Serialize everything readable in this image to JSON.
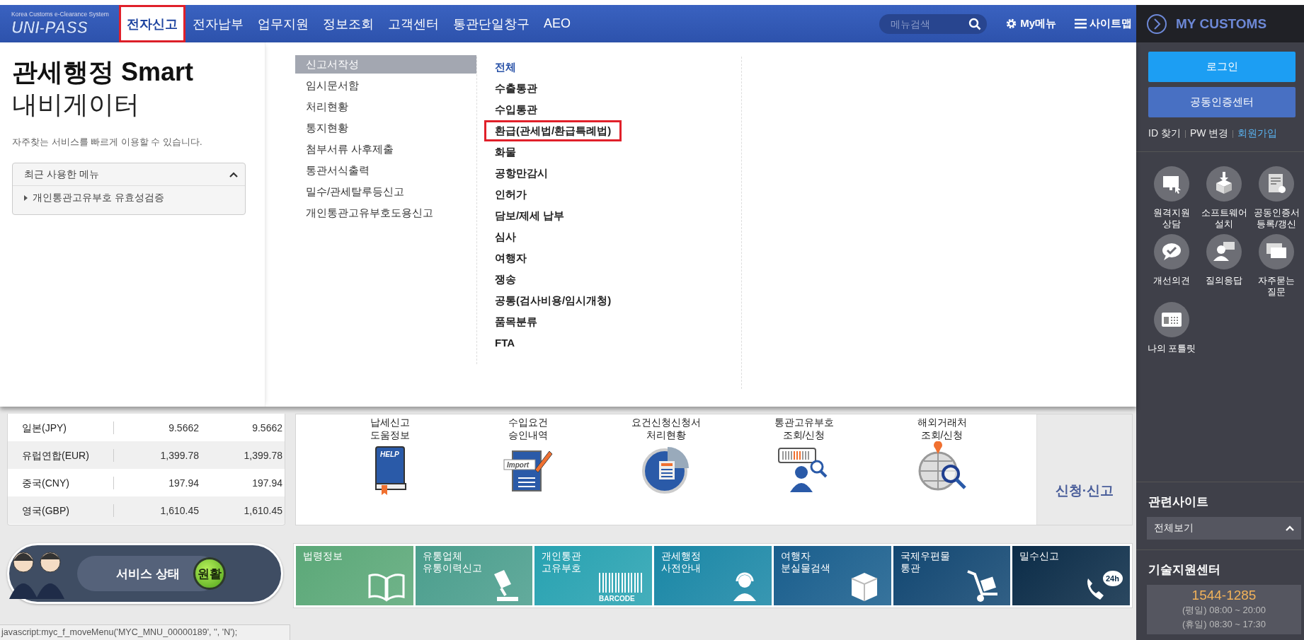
{
  "logo": {
    "subtitle": "Korea Customs e-Clearance System",
    "name": "UNI-PASS"
  },
  "nav": [
    {
      "label": "전자신고",
      "selected": true,
      "highlighted": true
    },
    {
      "label": "전자납부",
      "selected": false,
      "highlighted": false
    },
    {
      "label": "업무지원",
      "selected": false,
      "highlighted": false
    },
    {
      "label": "정보조회",
      "selected": false,
      "highlighted": false
    },
    {
      "label": "고객센터",
      "selected": false,
      "highlighted": false
    },
    {
      "label": "통관단일창구",
      "selected": false,
      "highlighted": false
    },
    {
      "label": "AEO",
      "selected": false,
      "highlighted": false
    }
  ],
  "search": {
    "placeholder": "메뉴검색"
  },
  "nav_tools": [
    {
      "label": "My메뉴",
      "kind": "settings"
    },
    {
      "label": "사이트맵",
      "kind": "sitemap"
    }
  ],
  "mega_menu": {
    "title_bold": "관세행정 Smart",
    "title_light": "내비게이터",
    "description": "자주찾는 서비스를 빠르게 이용할 수 있습니다.",
    "recent": {
      "title": "최근 사용한 메뉴",
      "expanded": true,
      "items": [
        "개인통관고유부호 유효성검증"
      ]
    },
    "categories": [
      {
        "label": "신고서작성",
        "selected": true
      },
      {
        "label": "임시문서함",
        "selected": false
      },
      {
        "label": "처리현황",
        "selected": false
      },
      {
        "label": "통지현황",
        "selected": false
      },
      {
        "label": "첨부서류 사후제출",
        "selected": false
      },
      {
        "label": "통관서식출력",
        "selected": false
      },
      {
        "label": "밀수/관세탈루등신고",
        "selected": false
      },
      {
        "label": "개인통관고유부호도용신고",
        "selected": false
      }
    ],
    "subcategories": [
      {
        "label": "전체",
        "selected": true,
        "highlighted": false
      },
      {
        "label": "수출통관",
        "selected": false,
        "highlighted": false
      },
      {
        "label": "수입통관",
        "selected": false,
        "highlighted": false
      },
      {
        "label": "환급(관세법/환급특례법)",
        "selected": false,
        "highlighted": true
      },
      {
        "label": "화물",
        "selected": false,
        "highlighted": false
      },
      {
        "label": "공항만감시",
        "selected": false,
        "highlighted": false
      },
      {
        "label": "인허가",
        "selected": false,
        "highlighted": false
      },
      {
        "label": "담보/제세 납부",
        "selected": false,
        "highlighted": false
      },
      {
        "label": "심사",
        "selected": false,
        "highlighted": false
      },
      {
        "label": "여행자",
        "selected": false,
        "highlighted": false
      },
      {
        "label": "쟁송",
        "selected": false,
        "highlighted": false
      },
      {
        "label": "공통(검사비용/임시개청)",
        "selected": false,
        "highlighted": false
      },
      {
        "label": "품목분류",
        "selected": false,
        "highlighted": false
      },
      {
        "label": "FTA",
        "selected": false,
        "highlighted": false
      }
    ]
  },
  "rates": [
    {
      "name": "일본(JPY)",
      "column_2": "9.5662",
      "column_3": "9.5662"
    },
    {
      "name": "유럽연합(EUR)",
      "column_2": "1,399.78",
      "column_3": "1,399.78"
    },
    {
      "name": "중국(CNY)",
      "column_2": "197.94",
      "column_3": "197.94"
    },
    {
      "name": "영국(GBP)",
      "column_2": "1,610.45",
      "column_3": "1,610.45"
    }
  ],
  "quick_services": [
    {
      "label": "납세신고\n도움정보",
      "kind": "help",
      "icon_text": "HELP"
    },
    {
      "label": "수입요건\n승인내역",
      "kind": "import",
      "icon_text": "Import"
    },
    {
      "label": "요건신청신청서\n처리현황",
      "kind": "chart"
    },
    {
      "label": "통관고유부호\n조회/신청",
      "kind": "barcode"
    },
    {
      "label": "해외거래처\n조회/신청",
      "kind": "globe"
    }
  ],
  "side_tab": "신청·신고",
  "service_status": {
    "label": "서비스 상태",
    "status": "원활"
  },
  "tiles": [
    {
      "label": "법령정보",
      "kind": "book",
      "color": "#5ba878"
    },
    {
      "label": "유통업체\n유통이력신고",
      "kind": "stamp",
      "color": "#4b9e8d"
    },
    {
      "label": "개인통관\n고유부호",
      "kind": "barcode",
      "color": "#28a2b1",
      "icon_text": "BARCODE"
    },
    {
      "label": "관세행정\n사전안내",
      "kind": "agent",
      "color": "#1a87a6"
    },
    {
      "label": "여행자\n분실물검색",
      "kind": "box",
      "color": "#195e8d"
    },
    {
      "label": "국제우편물\n통관",
      "kind": "cart",
      "color": "#124772"
    },
    {
      "label": "밀수신고",
      "kind": "phone",
      "color": "#0b2c48",
      "icon_text": "24h"
    }
  ],
  "status_bar": "javascript:myc_f_moveMenu('MYC_MNU_00000189', '', 'N');",
  "sidebar": {
    "title": "MY CUSTOMS",
    "buttons": [
      {
        "label": "로그인",
        "kind": "primary"
      },
      {
        "label": "공동인증센터",
        "kind": "secondary"
      }
    ],
    "links": [
      {
        "label": "ID 찾기",
        "emphasized": false
      },
      {
        "label": "PW 변경",
        "emphasized": false
      },
      {
        "label": "회원가입",
        "emphasized": true
      }
    ],
    "shortcuts": [
      {
        "label": "원격지원\n상담",
        "kind": "remote"
      },
      {
        "label": "소프트웨어\n설치",
        "kind": "software"
      },
      {
        "label": "공동인증서\n등록/갱신",
        "kind": "certificate"
      },
      {
        "label": "개선의견",
        "kind": "opinion"
      },
      {
        "label": "질의응답",
        "kind": "qna"
      },
      {
        "label": "자주묻는\n질문",
        "kind": "faq"
      },
      {
        "label": "나의 포틀릿",
        "kind": "portlet"
      }
    ],
    "related_sites": {
      "title": "관련사이트",
      "select": "전체보기",
      "expanded": true
    },
    "support": {
      "title": "기술지원센터",
      "phone": "1544-1285",
      "hours": [
        "(평일) 08:00 ~ 20:00",
        "(휴일) 08:30 ~ 17:30"
      ]
    }
  }
}
